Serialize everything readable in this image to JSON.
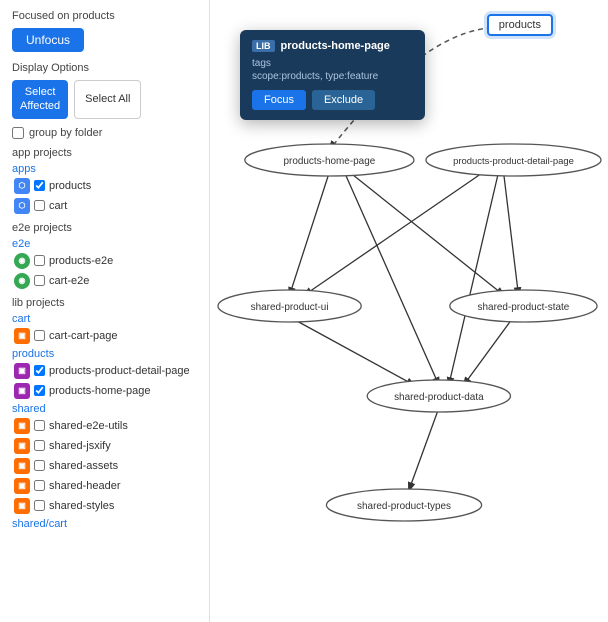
{
  "sidebar": {
    "focused_label": "Focused on products",
    "unfocus_btn": "Unfocus",
    "display_options_label": "Display Options",
    "select_affected_btn": "Select\nAffected",
    "select_all_btn": "Select All",
    "group_by_folder_label": "group by folder",
    "app_projects_label": "app projects",
    "app_section": "apps",
    "e2e_projects_label": "e2e projects",
    "e2e_section": "e2e",
    "lib_projects_label": "lib projects",
    "lib_cart_section": "cart",
    "lib_products_section": "products",
    "lib_shared_section": "shared",
    "lib_shared_cart_section": "shared/cart",
    "app_items": [
      {
        "name": "products",
        "checked": true,
        "icon": "apps"
      },
      {
        "name": "cart",
        "checked": false,
        "icon": "apps"
      }
    ],
    "e2e_items": [
      {
        "name": "products-e2e",
        "checked": false,
        "icon": "e2e"
      },
      {
        "name": "cart-e2e",
        "checked": false,
        "icon": "e2e"
      }
    ],
    "lib_cart_items": [
      {
        "name": "cart-cart-page",
        "checked": false,
        "icon": "lib"
      }
    ],
    "lib_products_items": [
      {
        "name": "products-product-detail-page",
        "checked": true,
        "icon": "lib2"
      },
      {
        "name": "products-home-page",
        "checked": true,
        "icon": "lib2"
      }
    ],
    "lib_shared_items": [
      {
        "name": "shared-e2e-utils",
        "checked": false,
        "icon": "lib"
      },
      {
        "name": "shared-jsxify",
        "checked": false,
        "icon": "lib"
      },
      {
        "name": "shared-assets",
        "checked": false,
        "icon": "lib"
      },
      {
        "name": "shared-header",
        "checked": false,
        "icon": "lib"
      },
      {
        "name": "shared-styles",
        "checked": false,
        "icon": "lib"
      }
    ]
  },
  "tooltip": {
    "lib_badge": "LIB",
    "title": "products-home-page",
    "tags_label": "tags",
    "tags": "scope:products, type:feature",
    "focus_btn": "Focus",
    "exclude_btn": "Exclude"
  },
  "graph": {
    "products_node": "products",
    "nodes": [
      "products-home-page",
      "products-product-detail-page",
      "shared-product-ui",
      "shared-product-state",
      "shared-product-data",
      "shared-product-types"
    ]
  }
}
